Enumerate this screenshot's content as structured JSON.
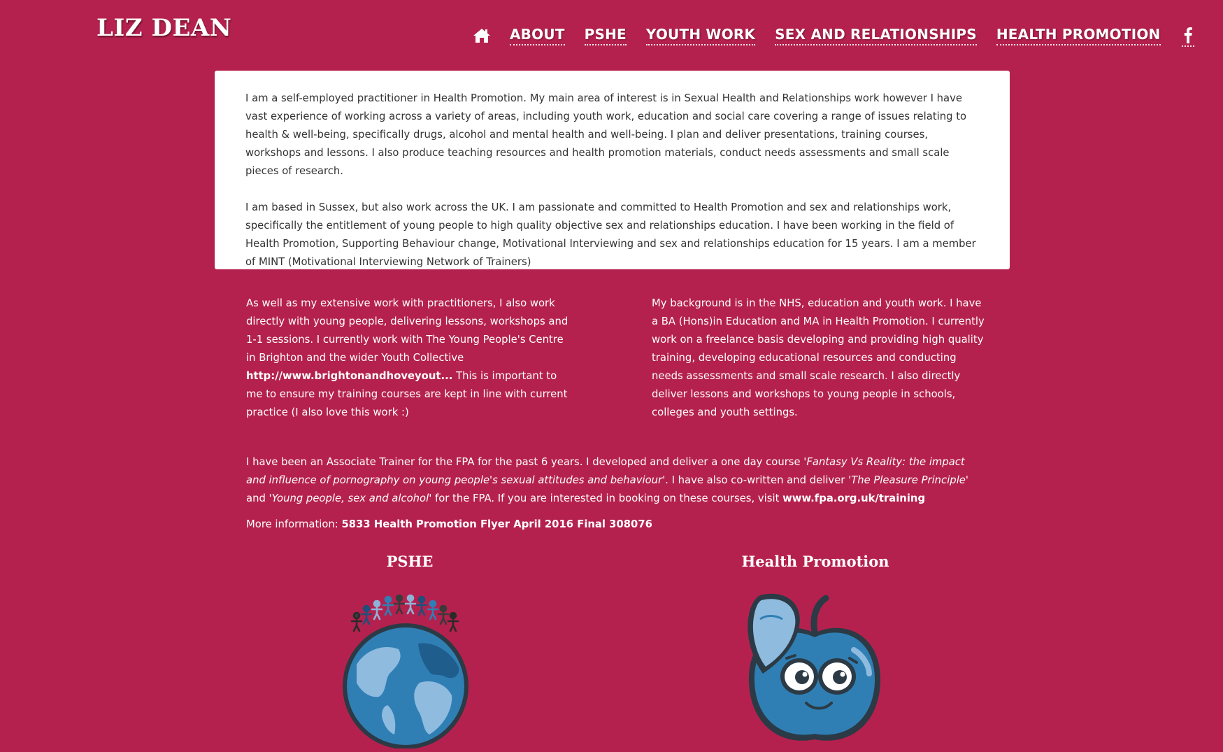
{
  "site": {
    "title": "LIZ DEAN"
  },
  "nav": {
    "home_icon": "home-icon",
    "items": [
      {
        "label": "ABOUT"
      },
      {
        "label": "PSHE"
      },
      {
        "label": "YOUTH WORK"
      },
      {
        "label": "SEX AND RELATIONSHIPS"
      },
      {
        "label": "HEALTH PROMOTION"
      }
    ],
    "facebook_icon": "facebook-icon"
  },
  "intro": {
    "p1": "I am a self-employed practitioner in Health Promotion. My main area of interest is in Sexual Health and Relationships work however I have vast experience of working across a variety of areas, including youth work, education and social care covering a range of issues relating to health & well-being, specifically drugs, alcohol and mental health and well-being. I plan and deliver presentations, training courses, workshops and lessons. I also produce teaching resources and health promotion materials, conduct needs assessments and small scale pieces of research.",
    "p2": "I am based in Sussex, but also work across the UK. I am passionate and committed to Health Promotion and sex and relationships work, specifically the entitlement of young people to high quality objective sex and relationships education. I have been working in the field of Health Promotion, Supporting Behaviour change, Motivational Interviewing and sex and relationships education for 15 years.  I am a member of MINT (Motivational Interviewing Network of Trainers)"
  },
  "left_col": {
    "text_before": "As well as my extensive work with practitioners, I also work directly with young people, delivering lessons, workshops and 1-1 sessions. I currently work with The Young People's Centre in Brighton and the wider Youth Collective ",
    "link": "http://www.brightonandhoveyout...",
    "text_after": " This is important to me to ensure my training courses are kept in line with current practice (I also love this work :)"
  },
  "right_col": {
    "text": "My background is in the NHS, education and youth work.  I have a BA (Hons)in Education and MA in Health Promotion.  I currently work on a freelance basis developing and providing high quality training, developing educational resources and conducting needs assessments and small scale research. I also directly deliver lessons and workshops to young people in schools, colleges and youth settings."
  },
  "fpa": {
    "t1": "I have been an Associate Trainer for the FPA for the past 6 years.  I developed and deliver a one  day course '",
    "course1": "Fantasy Vs Reality: the impact and influence of pornography on young people's sexual attitudes and behaviour",
    "t2": "'.  I have also co-written and deliver '",
    "course2": "The Pleasure Principle",
    "t3": "' and '",
    "course3": "Young people, sex and alcohol",
    "t4": "' for the FPA.  If you are interested in booking on these courses, visit ",
    "link": "www.fpa.org.uk/training"
  },
  "more_info": {
    "label": "More information: ",
    "link": "5833 Health Promotion Flyer April 2016 Final 308076"
  },
  "sections": {
    "pshe": {
      "title": "PSHE",
      "image": "globe-with-people-illustration"
    },
    "health_promotion": {
      "title": "Health Promotion",
      "image": "cartoon-apple-illustration"
    }
  },
  "colors": {
    "background": "#b5214e",
    "card": "#ffffff",
    "card_text": "#333333",
    "illustration_blue": "#2f7fb5",
    "illustration_outline": "#2b3a45"
  }
}
